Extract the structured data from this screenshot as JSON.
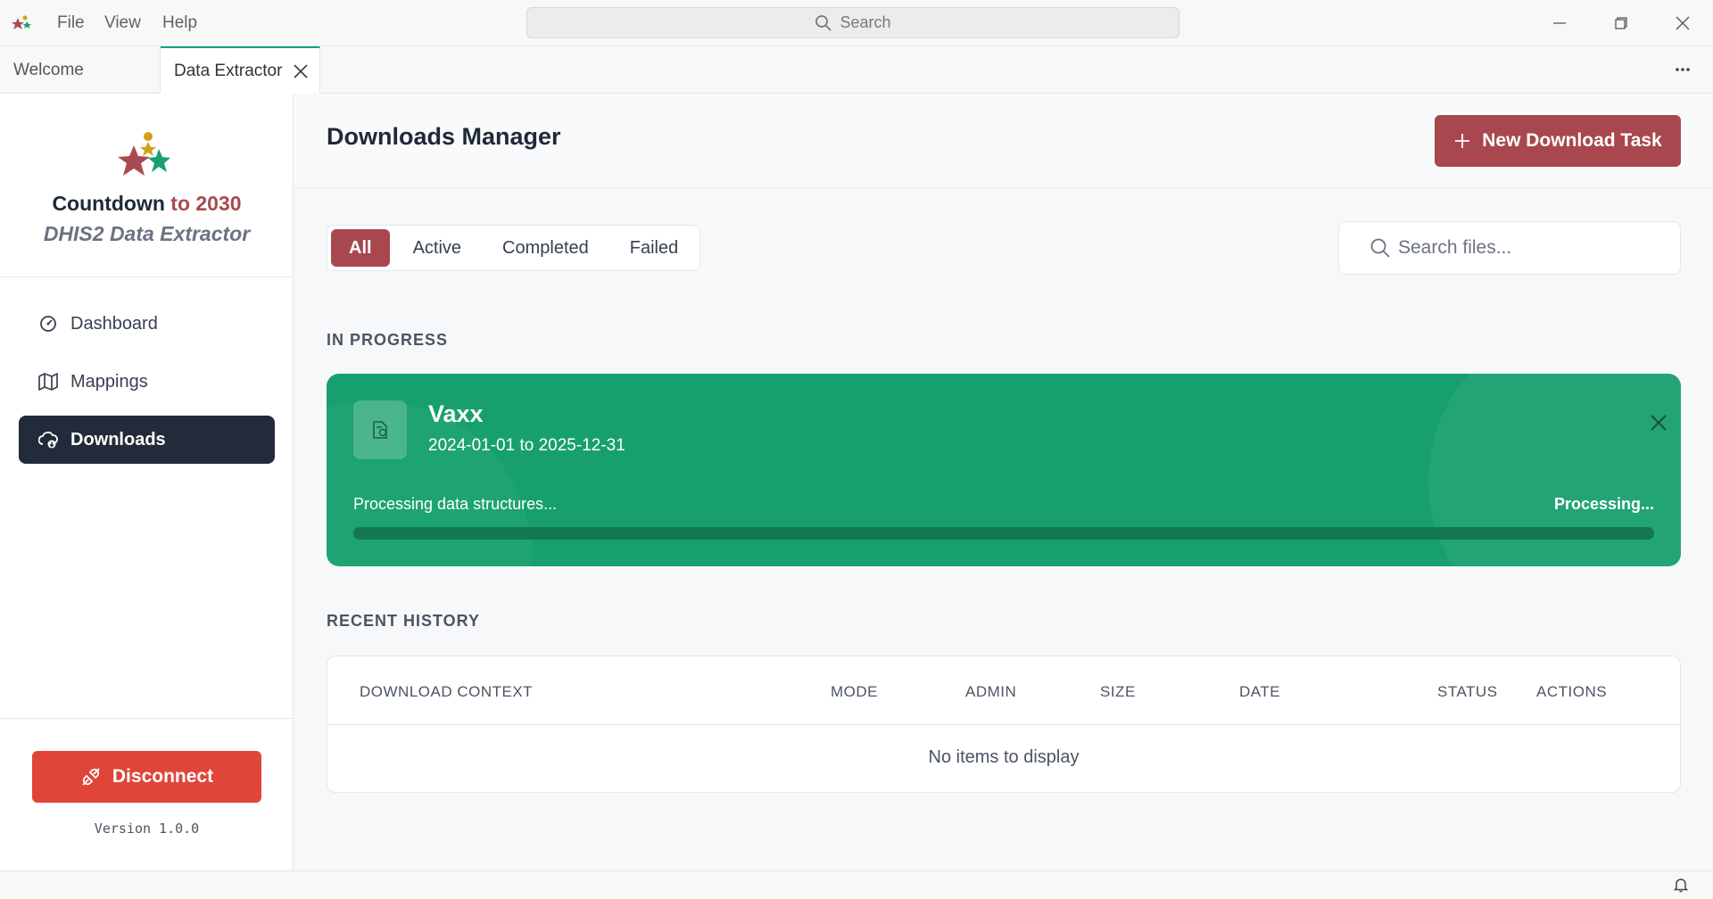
{
  "titlebar": {
    "menu": [
      "File",
      "View",
      "Help"
    ],
    "search_placeholder": "Search"
  },
  "tabs": [
    {
      "label": "Welcome"
    },
    {
      "label": "Data Extractor"
    }
  ],
  "sidebar": {
    "brand_line1_a": "Countdown",
    "brand_line1_b": "to 2030",
    "brand_line2": "DHIS2 Data Extractor",
    "nav": [
      {
        "label": "Dashboard",
        "icon": "dashboard-icon"
      },
      {
        "label": "Mappings",
        "icon": "map-icon"
      },
      {
        "label": "Downloads",
        "icon": "cloud-download-icon"
      }
    ],
    "disconnect_label": "Disconnect",
    "version": "Version 1.0.0"
  },
  "main": {
    "title": "Downloads Manager",
    "new_task_label": "New Download Task",
    "filters": [
      "All",
      "Active",
      "Completed",
      "Failed"
    ],
    "active_filter": "All",
    "search_placeholder": "Search files...",
    "in_progress_label": "IN PROGRESS",
    "task": {
      "name": "Vaxx",
      "range": "2024-01-01 to 2025-12-31",
      "status_text": "Processing data structures...",
      "status_right": "Processing...",
      "progress": 0
    },
    "history_label": "RECENT HISTORY",
    "table": {
      "headers": [
        "DOWNLOAD CONTEXT",
        "MODE",
        "ADMIN",
        "SIZE",
        "DATE",
        "STATUS",
        "ACTIONS"
      ],
      "empty": "No items to display"
    }
  },
  "colors": {
    "accent": "#a8474e",
    "success": "#17a06e",
    "danger": "#e0453a",
    "nav_active": "#232b3a"
  }
}
